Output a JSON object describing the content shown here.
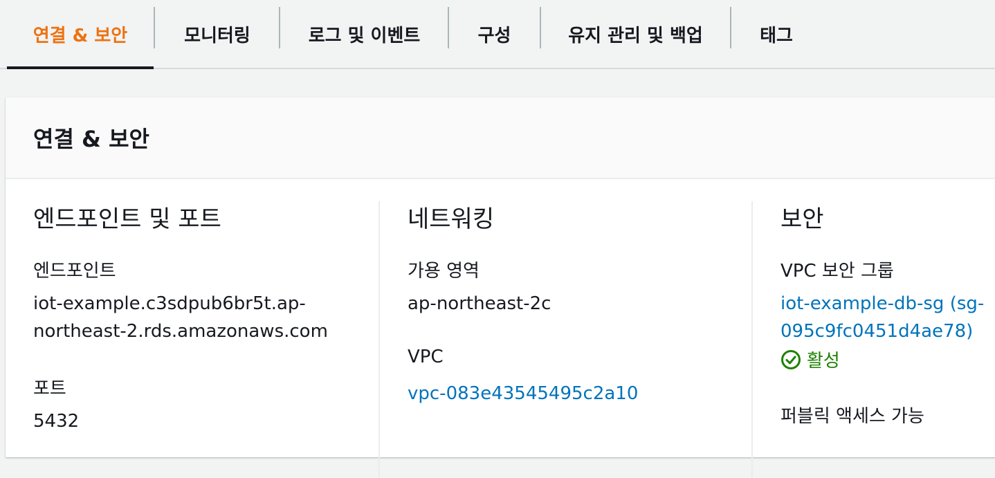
{
  "tabs": [
    {
      "label": "연결 & 보안",
      "active": true
    },
    {
      "label": "모니터링",
      "active": false
    },
    {
      "label": "로그 및 이벤트",
      "active": false
    },
    {
      "label": "구성",
      "active": false
    },
    {
      "label": "유지 관리 및 백업",
      "active": false
    },
    {
      "label": "태그",
      "active": false
    }
  ],
  "panel": {
    "title": "연결 & 보안"
  },
  "endpoint_section": {
    "title": "엔드포인트 및 포트",
    "endpoint_label": "엔드포인트",
    "endpoint_line1": "iot-example.c3sdpub6br5t.ap-",
    "endpoint_line2": "northeast-2.rds.amazonaws.com",
    "port_label": "포트",
    "port_value": "5432"
  },
  "network_section": {
    "title": "네트워킹",
    "az_label": "가용 영역",
    "az_value": "ap-northeast-2c",
    "vpc_label": "VPC",
    "vpc_value": "vpc-083e43545495c2a10"
  },
  "security_section": {
    "title": "보안",
    "sg_label": "VPC 보안 그룹",
    "sg_line1": "iot-example-db-sg (sg-",
    "sg_line2": "095c9fc0451d4ae78)",
    "sg_status": "활성",
    "public_label": "퍼블릭 액세스 가능"
  },
  "colors": {
    "accent": "#ec7211",
    "link": "#0073bb",
    "success": "#1d8102"
  }
}
